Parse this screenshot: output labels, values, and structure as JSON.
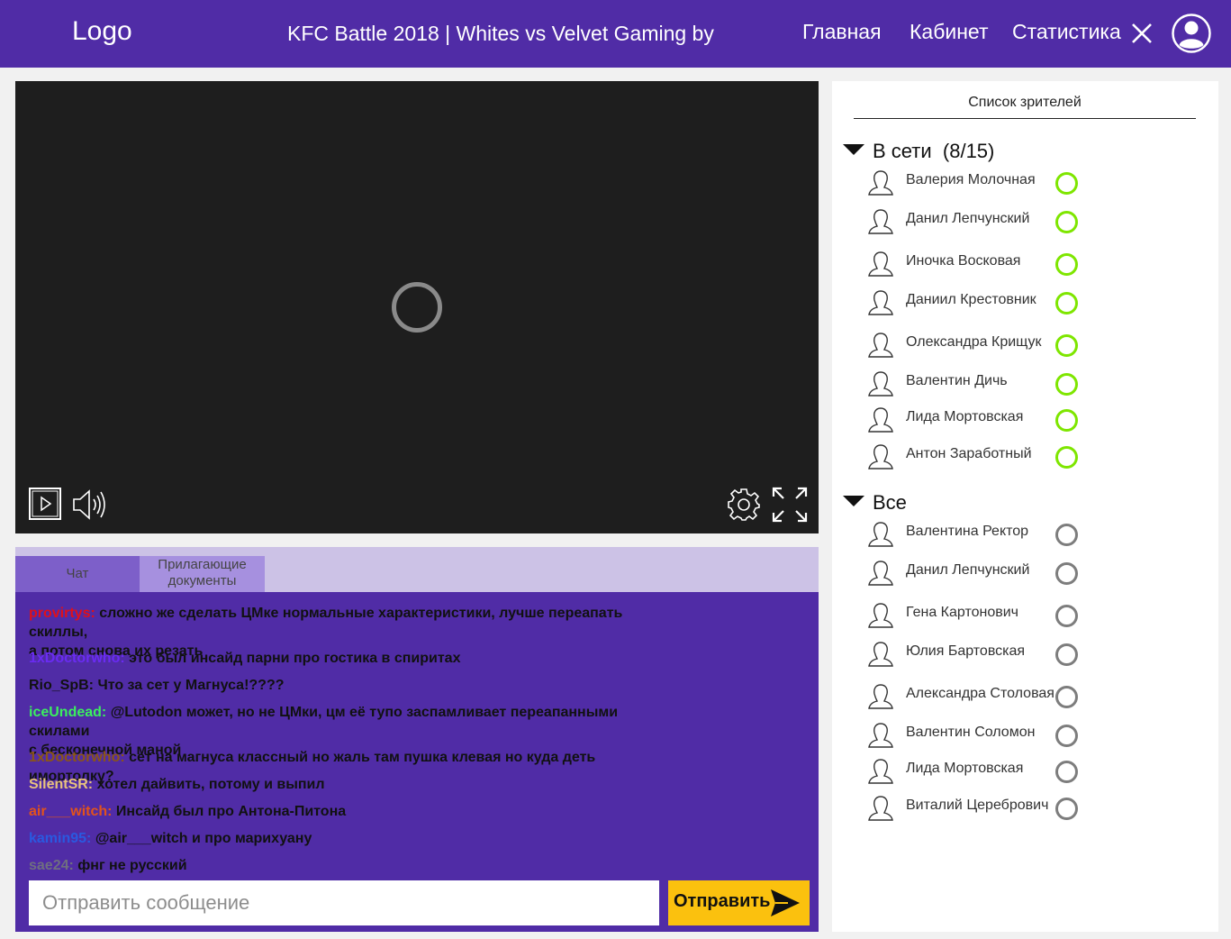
{
  "header": {
    "logo": "Logo",
    "title": "KFC Battle 2018 | Whites vs Velvet Gaming by",
    "nav": [
      "Главная",
      "Кабинет",
      "Статистика"
    ],
    "colors": {
      "bar": "#502ca6"
    }
  },
  "chat": {
    "tabs": {
      "chat": "Чат",
      "docs_line1": "Прилагающие",
      "docs_line2": "документы"
    },
    "messages": [
      {
        "user": "provirtys:",
        "color": "#e0101a",
        "text": " сложно же сделать ЦМке нормальные характеристики, лучше переапать скиллы,",
        "text2": "а потом снова их резать"
      },
      {
        "user": "1xDoctorwho:",
        "color": "#6a2bf2",
        "text": " это был инсайд парни про гостика в спиритах"
      },
      {
        "user": "Rio_SpB:",
        "color": "#111111",
        "text": " Что за сет у Магнуса!????"
      },
      {
        "user": "iceUndead:",
        "color": "#3bef5e",
        "text": " @Lutodon может, но не ЦМки, цм её тупо заспамливает переапанными скилами",
        "text2": "с бесконечной маной"
      },
      {
        "user": "1xDoctorwho:",
        "color": "#8a5518",
        "text": " сет на магнуса классный но жаль там пушка клевая но куда деть имортолку?"
      },
      {
        "user": "SilentSR:",
        "color": "#e8c27e",
        "text": " хотел дайвить, потому и выпил"
      },
      {
        "user": "air___witch:",
        "color": "#e2531b",
        "text": " Инсайд был про Антона-Питона"
      },
      {
        "user": "kamin95:",
        "color": "#2a59e0",
        "text": " @air___witch и про марихуану"
      },
      {
        "user": "sae24:",
        "color": "#6f6f80",
        "text": " фнг не русский"
      }
    ],
    "input_placeholder": "Отправить сообщение",
    "send_label": "Отправить",
    "colors": {
      "send": "#fbc10e"
    }
  },
  "viewers": {
    "title": "Список зрителей",
    "online_label": "В сети",
    "online_count": "(8/15)",
    "all_label": "Все",
    "online": [
      "Валерия Молочная",
      "Данил Лепчунский",
      "Иночка Восковая",
      "Даниил Крестовник",
      "Олександра Крищук",
      "Валентин Дичь",
      "Лида Мортовская",
      "Антон Заработный"
    ],
    "all": [
      "Валентина  Ректор",
      "Данил Лепчунский",
      "Гена Картонович",
      "Юлия Бартовская",
      "Александра Столовая",
      "Валентин Соломон",
      "Лида Мортовская",
      "Виталий Церебрович"
    ],
    "colors": {
      "online": "#7ee600",
      "offline": "#7d7d7d"
    }
  }
}
